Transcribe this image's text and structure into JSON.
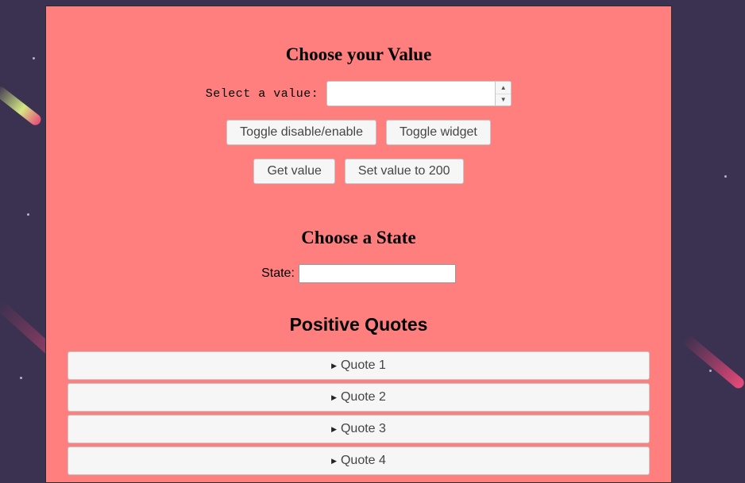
{
  "value_section": {
    "title": "Choose your Value",
    "select_label": "Select a value:",
    "spinner_value": "",
    "toggle_disable_label": "Toggle disable/enable",
    "toggle_widget_label": "Toggle widget",
    "get_value_label": "Get value",
    "set_value_label": "Set value to 200"
  },
  "state_section": {
    "title": "Choose a State",
    "label": "State:",
    "value": ""
  },
  "quotes_section": {
    "title": "Positive Quotes",
    "items": [
      {
        "label": "Quote 1"
      },
      {
        "label": "Quote 2"
      },
      {
        "label": "Quote 3"
      },
      {
        "label": "Quote 4"
      }
    ]
  },
  "icons": {
    "spin_up": "triangle-up-icon",
    "spin_down": "triangle-down-icon",
    "accordion_caret": "caret-right-icon"
  },
  "colors": {
    "page_background": "#3b3150",
    "panel_background": "#ff7f7f",
    "button_background": "#f6f6f6",
    "meteor": "#e84a7a"
  }
}
